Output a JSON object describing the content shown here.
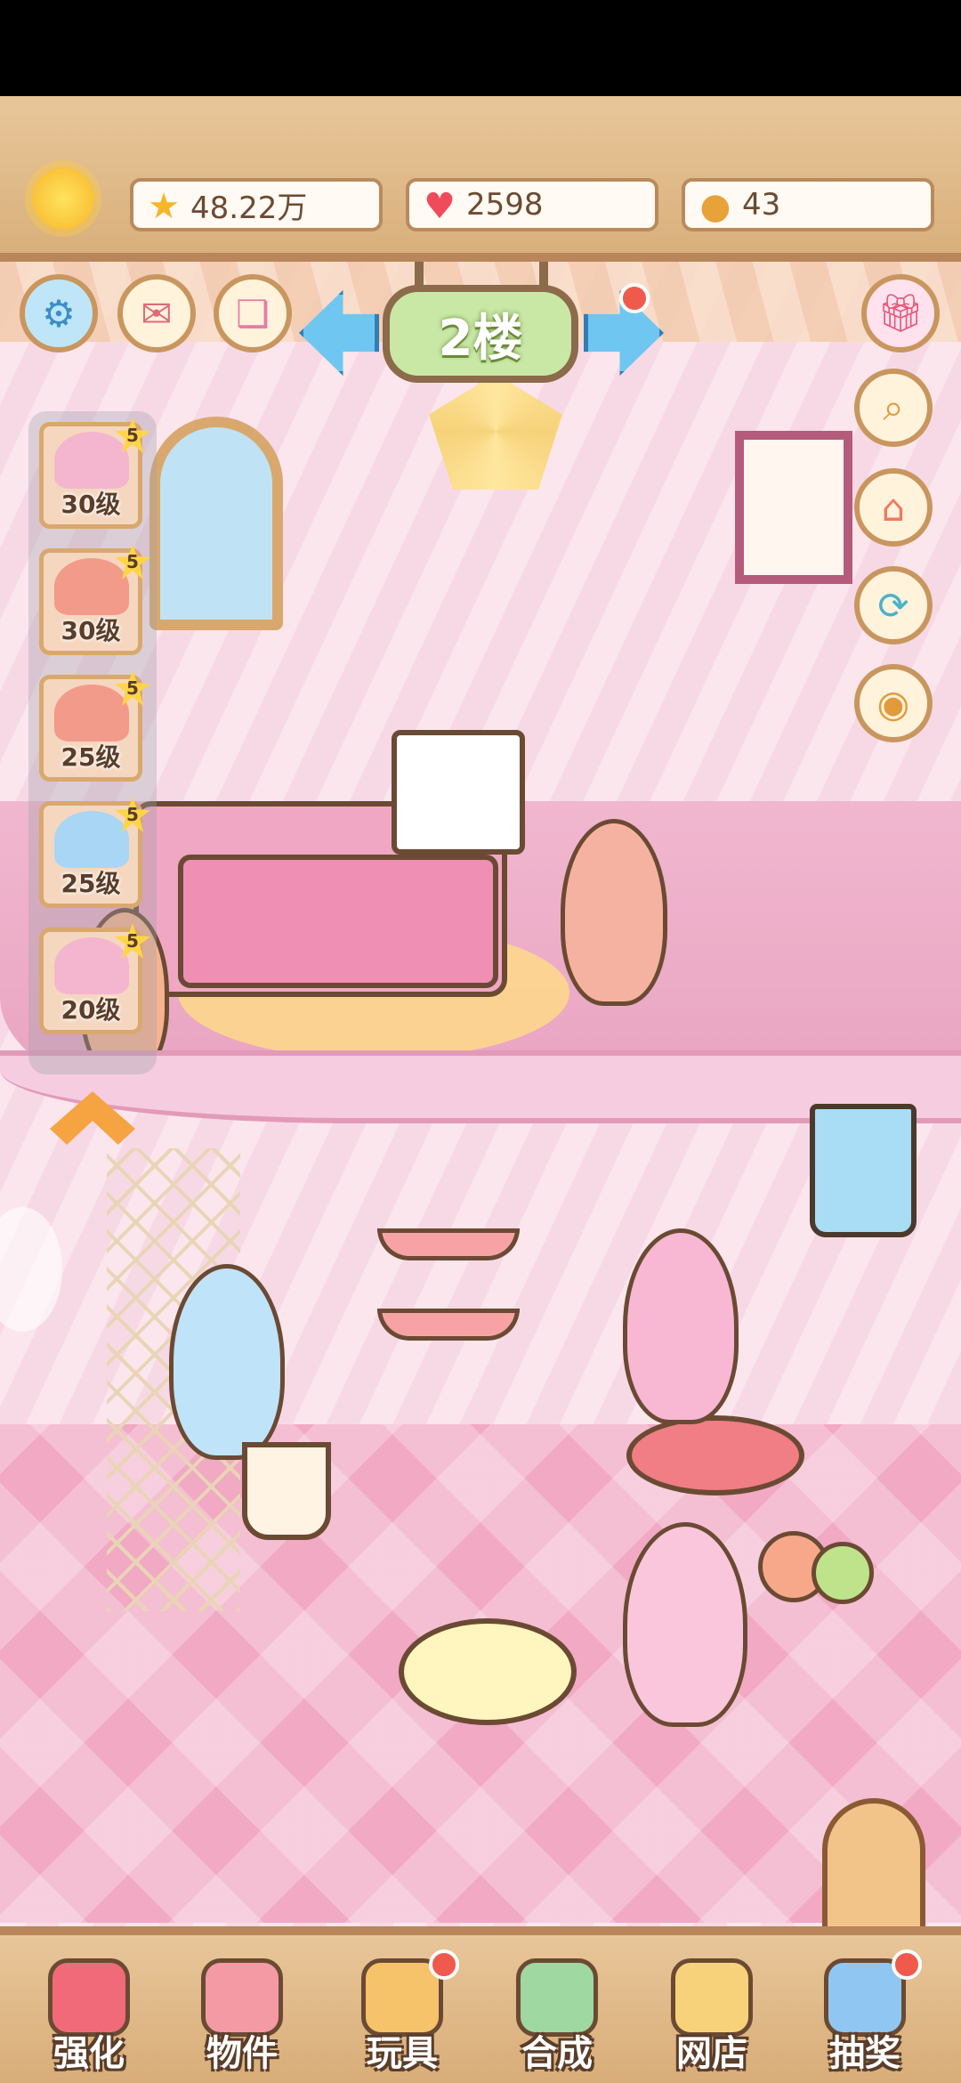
{
  "resources": {
    "stars": "48.22万",
    "hearts": "2598",
    "coins": "43"
  },
  "floor_sign": "2楼",
  "roster": [
    {
      "level": "30级",
      "stars": "5",
      "color": "#f4b6cf"
    },
    {
      "level": "30级",
      "stars": "5",
      "color": "#f39b8a"
    },
    {
      "level": "25级",
      "stars": "5",
      "color": "#f39b8a"
    },
    {
      "level": "25级",
      "stars": "5",
      "color": "#a9d6f5"
    },
    {
      "level": "20级",
      "stars": "5",
      "color": "#f4b6cf"
    }
  ],
  "icons": {
    "top": [
      "sun-icon",
      "star-icon",
      "heart-icon",
      "coin-icon"
    ],
    "left": [
      "gear-icon",
      "mail-icon",
      "book-icon"
    ],
    "right": [
      "gift-icon",
      "magnify-icon",
      "house-icon",
      "refresh-icon",
      "eye-icon"
    ]
  },
  "bottom_nav": [
    {
      "label": "强化",
      "color": "#f06a7a",
      "badge": false
    },
    {
      "label": "物件",
      "color": "#f49aa4",
      "badge": false
    },
    {
      "label": "玩具",
      "color": "#f6c26a",
      "badge": true
    },
    {
      "label": "合成",
      "color": "#9fd8a0",
      "badge": false
    },
    {
      "label": "网店",
      "color": "#f7d27a",
      "badge": false
    },
    {
      "label": "抽奖",
      "color": "#8fc7f2",
      "badge": true
    }
  ],
  "colors": {
    "wood": "#d9b07c",
    "wall": "#f7d9e6",
    "floor": "#f1a9c4",
    "badge_red": "#f05a4c"
  }
}
